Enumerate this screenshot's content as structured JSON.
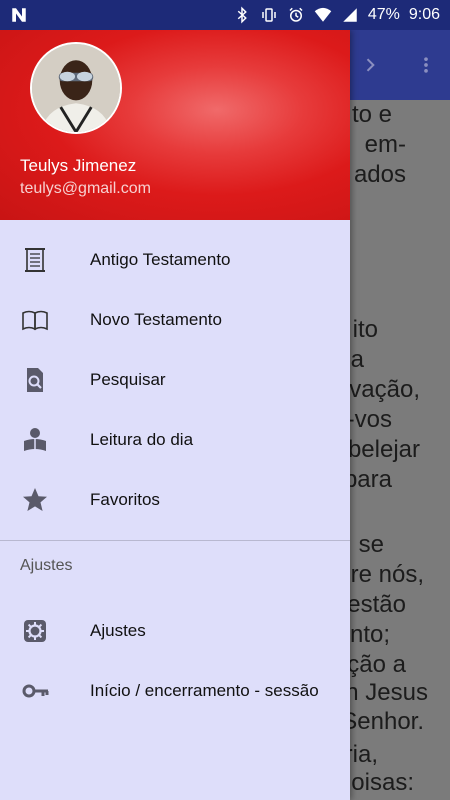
{
  "status_bar": {
    "battery": "47%",
    "time": "9:06",
    "icons": [
      "notification-n-icon",
      "bluetooth-icon",
      "vibrate-icon",
      "alarm-icon",
      "wifi-icon",
      "signal-icon",
      "battery-icon"
    ]
  },
  "app_bar": {
    "icons": [
      "chevron-right-icon",
      "overflow-menu-icon"
    ]
  },
  "background_text": [
    "to e",
    "em-",
    "ados",
    "ito",
    "a",
    "vação,",
    "-vos",
    "belejar",
    "para",
    "se",
    "re nós,",
    "estão",
    "nto;",
    "ção a",
    "n Jesus",
    "Senhor.",
    "ria,",
    "oisas:"
  ],
  "drawer": {
    "header": {
      "name": "Teulys Jimenez",
      "email": "teulys@gmail.com",
      "colors": {
        "primary": "#dc1a1a",
        "highlight": "#f06a6a"
      }
    },
    "items": [
      {
        "label": "Antigo Testamento",
        "icon": "scroll-icon"
      },
      {
        "label": "Novo Testamento",
        "icon": "book-open-icon"
      },
      {
        "label": "Pesquisar",
        "icon": "search-document-icon"
      },
      {
        "label": "Leitura do dia",
        "icon": "reader-icon"
      },
      {
        "label": "Favoritos",
        "icon": "star-icon"
      }
    ],
    "section_title": "Ajustes",
    "settings_items": [
      {
        "label": "Ajustes",
        "icon": "gear-icon"
      },
      {
        "label": "Início / encerramento - sessão",
        "icon": "key-icon"
      }
    ],
    "background_color": "#dedefa"
  }
}
